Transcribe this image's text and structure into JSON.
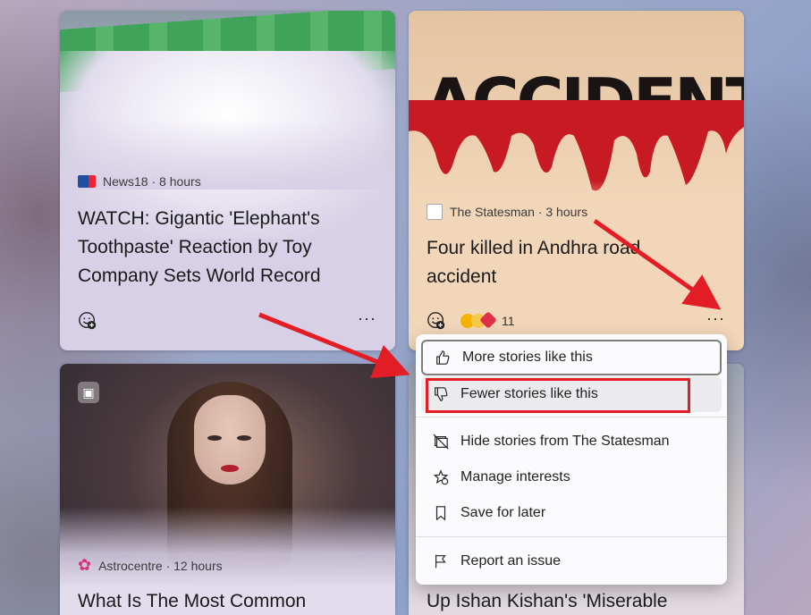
{
  "cards": [
    {
      "source": "News18 · 8 hours",
      "title": "WATCH: Gigantic 'Elephant's Toothpaste' Reaction by Toy Company Sets World Record",
      "more": "···"
    },
    {
      "image_text": "ACCIDENT",
      "source": "The Statesman · 3 hours",
      "title": "Four killed in Andhra road accident",
      "reaction_count": "11",
      "more": "···"
    },
    {
      "source": "Astrocentre · 12 hours",
      "title": "What Is The Most Common"
    },
    {
      "title": "Up Ishan Kishan's 'Miserable"
    }
  ],
  "menu": {
    "items": [
      {
        "label": "More stories like this",
        "icon": "thumbs-up-icon"
      },
      {
        "label": "Fewer stories like this",
        "icon": "thumbs-down-icon"
      },
      {
        "label": "Hide stories from The Statesman",
        "icon": "hide-icon"
      },
      {
        "label": "Manage interests",
        "icon": "gear-star-icon"
      },
      {
        "label": "Save for later",
        "icon": "bookmark-icon"
      },
      {
        "label": "Report an issue",
        "icon": "flag-icon"
      }
    ]
  },
  "colors": {
    "highlight": "#e21d25",
    "arrow": "#e21d25"
  }
}
